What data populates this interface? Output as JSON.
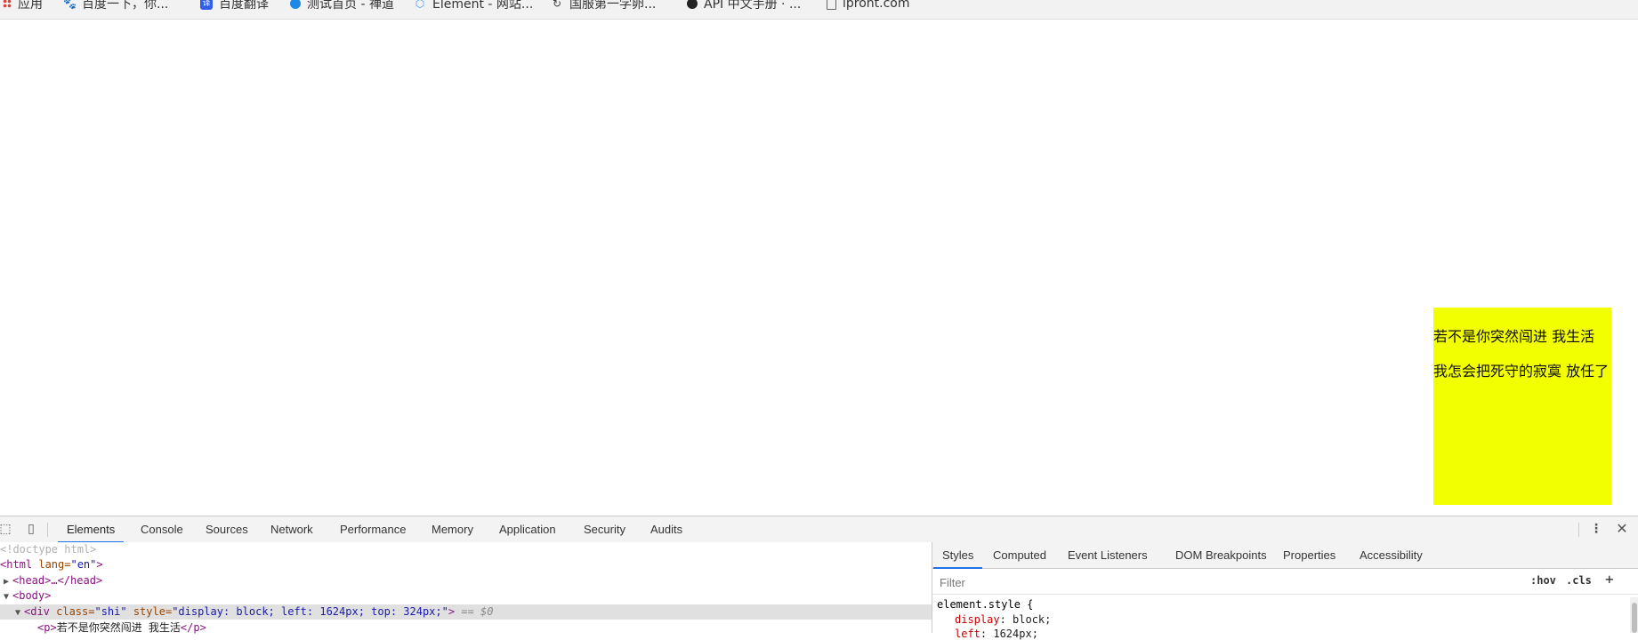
{
  "bookmarks": [
    {
      "label": "应用",
      "icon": "apps-grid-icon"
    },
    {
      "label": "百度一下，你...",
      "icon": "baidu-icon"
    },
    {
      "label": "百度翻译",
      "icon": "translate-icon"
    },
    {
      "label": "测试首页 - 禅道",
      "icon": "zentao-icon"
    },
    {
      "label": "Element - 网站...",
      "icon": "element-icon"
    },
    {
      "label": "国服第一学卵...",
      "icon": "link-icon"
    },
    {
      "label": "API 中文手册 · ...",
      "icon": "github-icon"
    },
    {
      "label": "lpront.com",
      "icon": "page-icon"
    }
  ],
  "yellow_box": {
    "color": "#f2ff00",
    "lines": [
      "若不是你突然闯进 我生活",
      "我怎会把死守的寂寞 放任了"
    ]
  },
  "devtools": {
    "tabs": [
      "Elements",
      "Console",
      "Sources",
      "Network",
      "Performance",
      "Memory",
      "Application",
      "Security",
      "Audits"
    ],
    "active_tab": "Elements",
    "dom": {
      "doctype": "<!doctype html>",
      "html_open": "<html",
      "html_attr_name": " lang=",
      "html_attr_val": "\"en\"",
      "html_close": ">",
      "head": "<head>…</head>",
      "body": "<body>",
      "div_open": "<div",
      "div_attr_class_name": " class=",
      "div_attr_class_val": "\"shi\"",
      "div_attr_style_name": " style=",
      "div_attr_style_val": "\"display: block; left: 1624px; top: 324px;\"",
      "div_close": ">",
      "selected_marker": " == $0",
      "p_open": "<p>",
      "p_text": "若不是你突然闯进 我生活",
      "p_close": "</p>"
    },
    "styles_tabs": [
      "Styles",
      "Computed",
      "Event Listeners",
      "DOM Breakpoints",
      "Properties",
      "Accessibility"
    ],
    "styles_active_tab": "Styles",
    "filter_placeholder": "Filter",
    "hov_label": ":hov",
    "cls_label": ".cls",
    "plus_label": "+",
    "element_style_selector": "element.style {",
    "props": [
      {
        "name": "display",
        "value": "block;"
      },
      {
        "name": "left",
        "value": "1624px;"
      }
    ]
  }
}
